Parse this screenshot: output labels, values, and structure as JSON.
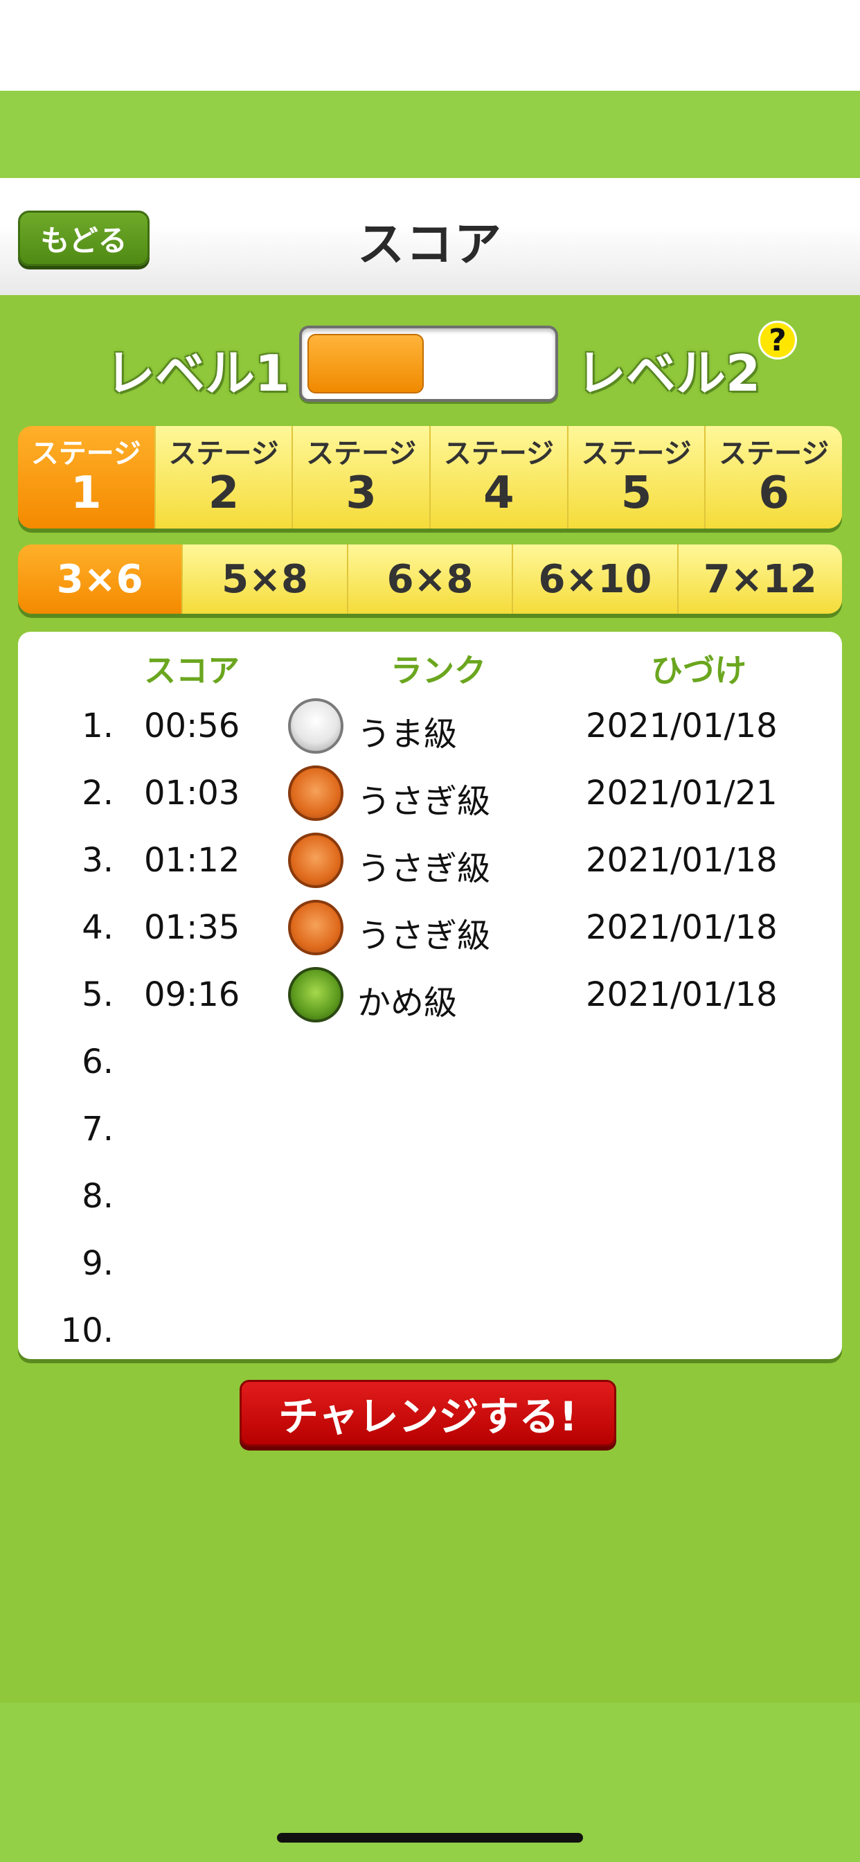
{
  "header": {
    "back_label": "もどる",
    "title": "スコア"
  },
  "level": {
    "left_label": "レベル1",
    "right_label": "レベル2",
    "help_label": "?",
    "toggle_fill": 0.48
  },
  "stage_tabs": [
    {
      "label": "ステージ",
      "number": "1",
      "active": true
    },
    {
      "label": "ステージ",
      "number": "2",
      "active": false
    },
    {
      "label": "ステージ",
      "number": "3",
      "active": false
    },
    {
      "label": "ステージ",
      "number": "4",
      "active": false
    },
    {
      "label": "ステージ",
      "number": "5",
      "active": false
    },
    {
      "label": "ステージ",
      "number": "6",
      "active": false
    }
  ],
  "grid_tabs": [
    {
      "label": "3×6",
      "active": true
    },
    {
      "label": "5×8",
      "active": false
    },
    {
      "label": "6×8",
      "active": false
    },
    {
      "label": "6×10",
      "active": false
    },
    {
      "label": "7×12",
      "active": false
    }
  ],
  "scores": {
    "columns": {
      "score": "スコア",
      "rank": "ランク",
      "date": "ひづけ"
    },
    "rows": [
      {
        "rank_no": "1.",
        "time": "00:56",
        "icon": "horse-medal-icon",
        "rank_name": "うま級",
        "date": "2021/01/18"
      },
      {
        "rank_no": "2.",
        "time": "01:03",
        "icon": "rabbit-medal-icon",
        "rank_name": "うさぎ級",
        "date": "2021/01/21"
      },
      {
        "rank_no": "3.",
        "time": "01:12",
        "icon": "rabbit-medal-icon",
        "rank_name": "うさぎ級",
        "date": "2021/01/18"
      },
      {
        "rank_no": "4.",
        "time": "01:35",
        "icon": "rabbit-medal-icon",
        "rank_name": "うさぎ級",
        "date": "2021/01/18"
      },
      {
        "rank_no": "5.",
        "time": "09:16",
        "icon": "turtle-medal-icon",
        "rank_name": "かめ級",
        "date": "2021/01/18"
      },
      {
        "rank_no": "6.",
        "time": "",
        "icon": "",
        "rank_name": "",
        "date": ""
      },
      {
        "rank_no": "7.",
        "time": "",
        "icon": "",
        "rank_name": "",
        "date": ""
      },
      {
        "rank_no": "8.",
        "time": "",
        "icon": "",
        "rank_name": "",
        "date": ""
      },
      {
        "rank_no": "9.",
        "time": "",
        "icon": "",
        "rank_name": "",
        "date": ""
      },
      {
        "rank_no": "10.",
        "time": "",
        "icon": "",
        "rank_name": "",
        "date": ""
      }
    ]
  },
  "challenge_label": "チャレンジする!",
  "colors": {
    "background_green": "#8fc83a",
    "tab_yellow": "#f5dc3a",
    "tab_active_orange": "#f48a00",
    "header_green_text": "#6aa61e",
    "challenge_red": "#d00000",
    "back_button_green": "#5a9a1e"
  }
}
